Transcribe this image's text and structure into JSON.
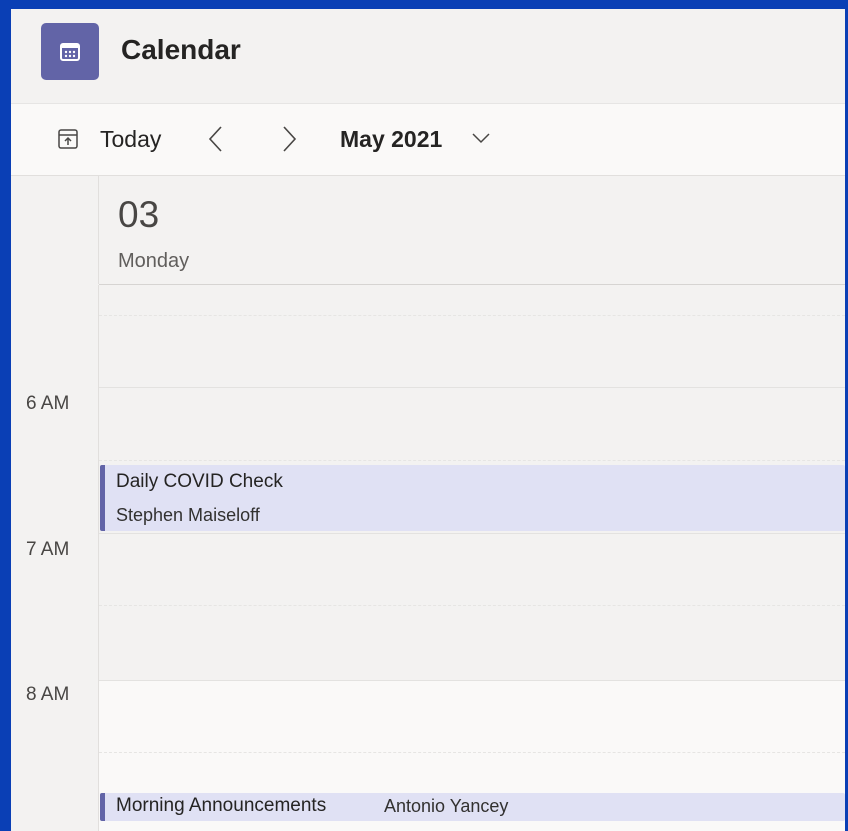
{
  "app": {
    "title": "Calendar",
    "icon": "calendar-icon",
    "accent_color": "#6264a7"
  },
  "toolbar": {
    "today_label": "Today",
    "month_label": "May 2021"
  },
  "day": {
    "number": "03",
    "name": "Monday"
  },
  "time_labels": [
    "6 AM",
    "7 AM",
    "8 AM"
  ],
  "events": [
    {
      "title": "Daily COVID Check",
      "organizer": "Stephen Maiseloff"
    },
    {
      "title": "Morning Announcements",
      "organizer": "Antonio Yancey"
    }
  ]
}
